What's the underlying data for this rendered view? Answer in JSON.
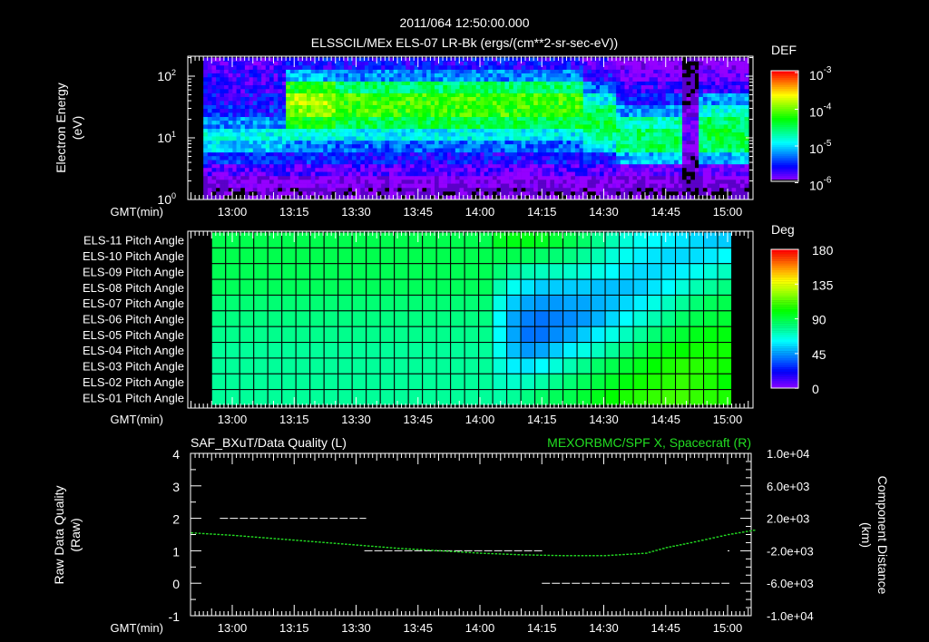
{
  "header": {
    "time": "2011/064 12:50:00.000",
    "title": "ELSSCIL/MEx ELS-07 LR-Bk  (ergs/(cm**2-sr-sec-eV))"
  },
  "x_axis_label": "GMT(min)",
  "x_tick_labels": [
    "13:00",
    "13:15",
    "13:30",
    "13:45",
    "14:00",
    "14:15",
    "14:30",
    "14:45",
    "15:00"
  ],
  "chart_data": [
    {
      "type": "heatmap",
      "ylabel": "Electron Energy",
      "yunit": "(eV)",
      "yscale": "log",
      "ylim": [
        1,
        200
      ],
      "y_tick_labels": [
        "10",
        "10",
        "10"
      ],
      "y_tick_exponents": [
        "0",
        "1",
        "2"
      ],
      "time_range": [
        "12:53",
        "15:05"
      ],
      "colorbar": {
        "label": "DEF",
        "scale": "log",
        "range": [
          1e-06,
          0.001
        ],
        "tick_base": [
          "10",
          "10",
          "10",
          "10"
        ],
        "tick_exponents": [
          "-3",
          "-4",
          "-5",
          "-6"
        ]
      },
      "log10_def_by_time_bin": [
        [
          -6.4,
          -6.2,
          -5.9,
          -5.6,
          -5.1,
          -5.0,
          -5.3,
          -5.6,
          -5.7,
          -5.8,
          -5.8,
          -5.9
        ],
        [
          -6.4,
          -6.2,
          -5.9,
          -5.6,
          -5.1,
          -5.0,
          -5.3,
          -5.6,
          -5.7,
          -5.8,
          -5.8,
          -5.9
        ],
        [
          -6.4,
          -6.2,
          -5.9,
          -5.6,
          -5.1,
          -5.0,
          -5.3,
          -5.6,
          -5.7,
          -5.8,
          -5.8,
          -5.9
        ],
        [
          -6.4,
          -6.2,
          -5.9,
          -5.6,
          -5.1,
          -5.0,
          -5.3,
          -5.6,
          -5.7,
          -5.8,
          -5.8,
          -5.9
        ],
        [
          -6.4,
          -6.2,
          -5.9,
          -5.6,
          -5.1,
          -5.0,
          -5.3,
          -5.6,
          -5.7,
          -5.8,
          -5.8,
          -5.9
        ],
        [
          -6.4,
          -6.2,
          -5.9,
          -5.6,
          -5.3,
          -4.9,
          -4.4,
          -4.0,
          -3.9,
          -4.3,
          -5.2,
          -5.7
        ],
        [
          -6.4,
          -6.2,
          -5.9,
          -5.6,
          -5.3,
          -4.9,
          -4.4,
          -4.0,
          -3.9,
          -4.3,
          -5.2,
          -5.7
        ],
        [
          -6.4,
          -6.2,
          -5.9,
          -5.6,
          -5.3,
          -4.9,
          -4.4,
          -4.0,
          -3.9,
          -4.3,
          -5.2,
          -5.7
        ],
        [
          -6.4,
          -6.2,
          -5.9,
          -5.7,
          -5.4,
          -5.0,
          -4.5,
          -4.2,
          -4.2,
          -4.6,
          -5.3,
          -5.7
        ],
        [
          -6.4,
          -6.2,
          -5.9,
          -5.7,
          -5.4,
          -5.0,
          -4.5,
          -4.2,
          -4.2,
          -4.6,
          -5.3,
          -5.7
        ],
        [
          -6.4,
          -6.2,
          -5.9,
          -5.7,
          -5.4,
          -5.0,
          -4.5,
          -4.2,
          -4.2,
          -4.6,
          -5.3,
          -5.7
        ],
        [
          -6.4,
          -6.2,
          -5.9,
          -5.7,
          -5.4,
          -5.0,
          -4.5,
          -4.2,
          -4.2,
          -4.6,
          -5.3,
          -5.7
        ],
        [
          -6.4,
          -6.2,
          -5.9,
          -5.7,
          -5.4,
          -5.0,
          -4.5,
          -4.2,
          -4.2,
          -4.6,
          -5.3,
          -5.7
        ],
        [
          -6.4,
          -6.2,
          -5.9,
          -5.7,
          -5.4,
          -5.0,
          -4.5,
          -4.2,
          -4.2,
          -4.6,
          -5.3,
          -5.7
        ],
        [
          -6.4,
          -6.2,
          -5.9,
          -5.7,
          -5.4,
          -5.0,
          -4.5,
          -4.2,
          -4.2,
          -4.6,
          -5.3,
          -5.7
        ],
        [
          -6.4,
          -6.2,
          -5.9,
          -5.7,
          -5.4,
          -5.0,
          -4.5,
          -4.2,
          -4.2,
          -4.6,
          -5.3,
          -5.7
        ],
        [
          -6.4,
          -6.2,
          -5.9,
          -5.7,
          -5.4,
          -5.0,
          -4.5,
          -4.2,
          -4.2,
          -4.6,
          -5.3,
          -5.7
        ],
        [
          -6.4,
          -6.2,
          -5.9,
          -5.7,
          -5.4,
          -5.0,
          -4.5,
          -4.2,
          -4.2,
          -4.6,
          -5.3,
          -5.7
        ],
        [
          -6.4,
          -6.2,
          -5.9,
          -5.7,
          -5.4,
          -5.0,
          -4.5,
          -4.2,
          -4.2,
          -4.6,
          -5.3,
          -5.7
        ],
        [
          -6.4,
          -6.2,
          -5.9,
          -5.7,
          -5.4,
          -5.0,
          -4.5,
          -4.2,
          -4.2,
          -4.6,
          -5.3,
          -5.7
        ],
        [
          -6.4,
          -6.2,
          -5.9,
          -5.7,
          -5.4,
          -5.0,
          -4.5,
          -4.2,
          -4.2,
          -4.6,
          -5.3,
          -5.7
        ],
        [
          -6.4,
          -6.2,
          -5.9,
          -5.7,
          -5.4,
          -5.0,
          -4.5,
          -4.2,
          -4.2,
          -4.6,
          -5.3,
          -5.7
        ],
        [
          -6.4,
          -6.2,
          -5.9,
          -5.7,
          -5.4,
          -5.0,
          -4.5,
          -4.2,
          -4.2,
          -4.6,
          -5.3,
          -5.7
        ],
        [
          -6.4,
          -6.2,
          -5.9,
          -5.6,
          -5.0,
          -4.7,
          -4.5,
          -4.6,
          -5.0,
          -5.4,
          -5.7,
          -5.9
        ],
        [
          -6.4,
          -6.2,
          -5.9,
          -5.6,
          -5.0,
          -4.7,
          -4.5,
          -4.6,
          -5.0,
          -5.4,
          -5.7,
          -5.9
        ],
        [
          -6.5,
          -6.3,
          -6.0,
          -5.2,
          -4.6,
          -4.6,
          -4.8,
          -5.3,
          -5.6,
          -5.8,
          -6.0,
          -6.2
        ],
        [
          -6.5,
          -6.3,
          -6.0,
          -5.2,
          -4.6,
          -4.6,
          -4.8,
          -5.3,
          -5.6,
          -5.8,
          -6.0,
          -6.2
        ],
        [
          -6.5,
          -6.3,
          -6.0,
          -5.2,
          -4.6,
          -4.6,
          -4.8,
          -5.3,
          -5.6,
          -5.8,
          -6.0,
          -6.2
        ],
        [
          -6.5,
          -6.3,
          -6.0,
          -5.2,
          -4.6,
          -4.6,
          -4.8,
          -5.3,
          -5.6,
          -5.8,
          -6.0,
          -6.2
        ],
        [
          -6.6,
          -6.6,
          -6.5,
          -6.4,
          -6.2,
          -6.0,
          -6.0,
          -6.2,
          -6.4,
          -6.5,
          -6.6,
          -6.6
        ],
        [
          -6.5,
          -6.3,
          -6.0,
          -5.2,
          -4.6,
          -4.5,
          -4.6,
          -4.9,
          -5.3,
          -5.8,
          -6.0,
          -6.2
        ],
        [
          -6.5,
          -6.3,
          -6.0,
          -5.2,
          -4.6,
          -4.5,
          -4.6,
          -4.9,
          -5.3,
          -5.8,
          -6.0,
          -6.2
        ],
        [
          -6.5,
          -6.3,
          -6.0,
          -5.2,
          -4.6,
          -4.5,
          -4.6,
          -4.9,
          -5.3,
          -5.8,
          -6.0,
          -6.2
        ]
      ]
    },
    {
      "type": "heatmap",
      "row_labels": [
        "ELS-11 Pitch Angle",
        "ELS-10 Pitch Angle",
        "ELS-09 Pitch Angle",
        "ELS-08 Pitch Angle",
        "ELS-07 Pitch Angle",
        "ELS-06 Pitch Angle",
        "ELS-05 Pitch Angle",
        "ELS-04 Pitch Angle",
        "ELS-03 Pitch Angle",
        "ELS-02 Pitch Angle",
        "ELS-01 Pitch Angle"
      ],
      "time_range": [
        "12:55",
        "15:01"
      ],
      "colorbar": {
        "label": "Deg",
        "range": [
          0,
          180
        ],
        "tick_labels": [
          "180",
          "135",
          "90",
          "45",
          "0"
        ]
      },
      "values_deg": [
        [
          88,
          88,
          88,
          88,
          88,
          88,
          88,
          88,
          88,
          88,
          88,
          88,
          88,
          88,
          88,
          88,
          88,
          88,
          88,
          88,
          95,
          97,
          97,
          95,
          92,
          88,
          84,
          78,
          72,
          66,
          62,
          60,
          58,
          56,
          54,
          52,
          52
        ],
        [
          88,
          88,
          88,
          88,
          88,
          88,
          88,
          88,
          88,
          88,
          88,
          88,
          88,
          88,
          88,
          88,
          88,
          88,
          88,
          88,
          88,
          88,
          86,
          84,
          82,
          80,
          76,
          72,
          66,
          62,
          58,
          56,
          54,
          54,
          55,
          57,
          60
        ],
        [
          87,
          87,
          87,
          87,
          87,
          87,
          87,
          87,
          87,
          87,
          87,
          87,
          87,
          87,
          87,
          87,
          87,
          87,
          87,
          87,
          82,
          76,
          72,
          70,
          70,
          68,
          66,
          64,
          60,
          56,
          54,
          54,
          56,
          58,
          62,
          66,
          70
        ],
        [
          86,
          86,
          86,
          86,
          86,
          86,
          86,
          86,
          86,
          86,
          86,
          86,
          86,
          86,
          86,
          86,
          86,
          86,
          86,
          86,
          72,
          62,
          56,
          52,
          52,
          52,
          52,
          50,
          50,
          50,
          52,
          56,
          60,
          66,
          72,
          76,
          80
        ],
        [
          82,
          82,
          82,
          82,
          82,
          82,
          82,
          82,
          82,
          82,
          82,
          82,
          82,
          82,
          82,
          82,
          82,
          82,
          82,
          82,
          64,
          52,
          46,
          44,
          44,
          46,
          46,
          48,
          50,
          54,
          58,
          64,
          70,
          76,
          82,
          86,
          88
        ],
        [
          80,
          80,
          80,
          80,
          80,
          80,
          80,
          80,
          80,
          80,
          80,
          80,
          80,
          80,
          80,
          80,
          80,
          80,
          80,
          80,
          60,
          46,
          40,
          38,
          40,
          42,
          44,
          48,
          54,
          60,
          66,
          72,
          78,
          84,
          88,
          90,
          92
        ],
        [
          78,
          78,
          78,
          78,
          78,
          78,
          78,
          78,
          78,
          78,
          78,
          78,
          78,
          78,
          78,
          78,
          78,
          78,
          78,
          78,
          60,
          46,
          38,
          38,
          42,
          46,
          52,
          58,
          64,
          70,
          76,
          82,
          88,
          92,
          96,
          98,
          98
        ],
        [
          76,
          76,
          76,
          76,
          76,
          76,
          76,
          76,
          76,
          76,
          76,
          76,
          76,
          76,
          76,
          76,
          76,
          76,
          76,
          76,
          62,
          50,
          44,
          46,
          52,
          58,
          64,
          70,
          76,
          82,
          88,
          94,
          98,
          100,
          102,
          102,
          102
        ],
        [
          76,
          76,
          76,
          76,
          76,
          76,
          76,
          76,
          76,
          76,
          76,
          76,
          76,
          76,
          76,
          76,
          76,
          76,
          76,
          76,
          66,
          58,
          56,
          60,
          66,
          72,
          78,
          84,
          88,
          92,
          96,
          100,
          104,
          106,
          106,
          104,
          102
        ],
        [
          76,
          76,
          76,
          76,
          76,
          76,
          76,
          76,
          76,
          76,
          76,
          76,
          76,
          76,
          76,
          76,
          76,
          76,
          76,
          76,
          70,
          68,
          70,
          74,
          78,
          82,
          86,
          90,
          94,
          98,
          102,
          104,
          106,
          108,
          106,
          104,
          100
        ],
        [
          76,
          76,
          76,
          76,
          76,
          76,
          76,
          76,
          76,
          76,
          76,
          76,
          76,
          76,
          76,
          76,
          76,
          76,
          76,
          76,
          74,
          76,
          80,
          84,
          86,
          88,
          92,
          96,
          100,
          104,
          106,
          108,
          110,
          110,
          108,
          106,
          104
        ]
      ]
    },
    {
      "type": "line",
      "title_left": "SAF_BXuT/Data Quality (L)",
      "title_right": "MEXORBMC/SPF X, Spacecraft (R)",
      "ylabel_left": "Raw Data Quality",
      "yunit_left": "(Raw)",
      "ylabel_right": "Component Distance",
      "yunit_right": "(km)",
      "ylim_left": [
        -1,
        4
      ],
      "ylim_right": [
        -10000,
        10000
      ],
      "y_tick_labels_left": [
        "4",
        "3",
        "2",
        "1",
        "0",
        "-1"
      ],
      "y_tick_labels_right": [
        "1.0e+04",
        "6.0e+03",
        "2.0e+03",
        "-2.0e+03",
        "-6.0e+03",
        "-1.0e+04"
      ],
      "line_color_left": "#ffffff",
      "line_color_right": "#22dd22",
      "data_quality_segments": [
        {
          "start": "12:57",
          "end": "13:32",
          "value": 2
        },
        {
          "start": "13:32",
          "end": "14:15",
          "value": 1
        },
        {
          "start": "14:15",
          "end": "15:00",
          "value": 0
        },
        {
          "start": "15:00",
          "end": "15:00",
          "value": 1
        }
      ],
      "spf_x_km": {
        "x": [
          "12:50",
          "13:00",
          "13:10",
          "13:20",
          "13:30",
          "13:40",
          "13:50",
          "14:00",
          "14:10",
          "14:20",
          "14:30",
          "14:40",
          "14:45",
          "14:50",
          "15:00",
          "15:07"
        ],
        "y": [
          200,
          -100,
          -500,
          -900,
          -1300,
          -1700,
          -2000,
          -2300,
          -2500,
          -2600,
          -2600,
          -2300,
          -1600,
          -1100,
          0,
          600
        ]
      }
    }
  ]
}
